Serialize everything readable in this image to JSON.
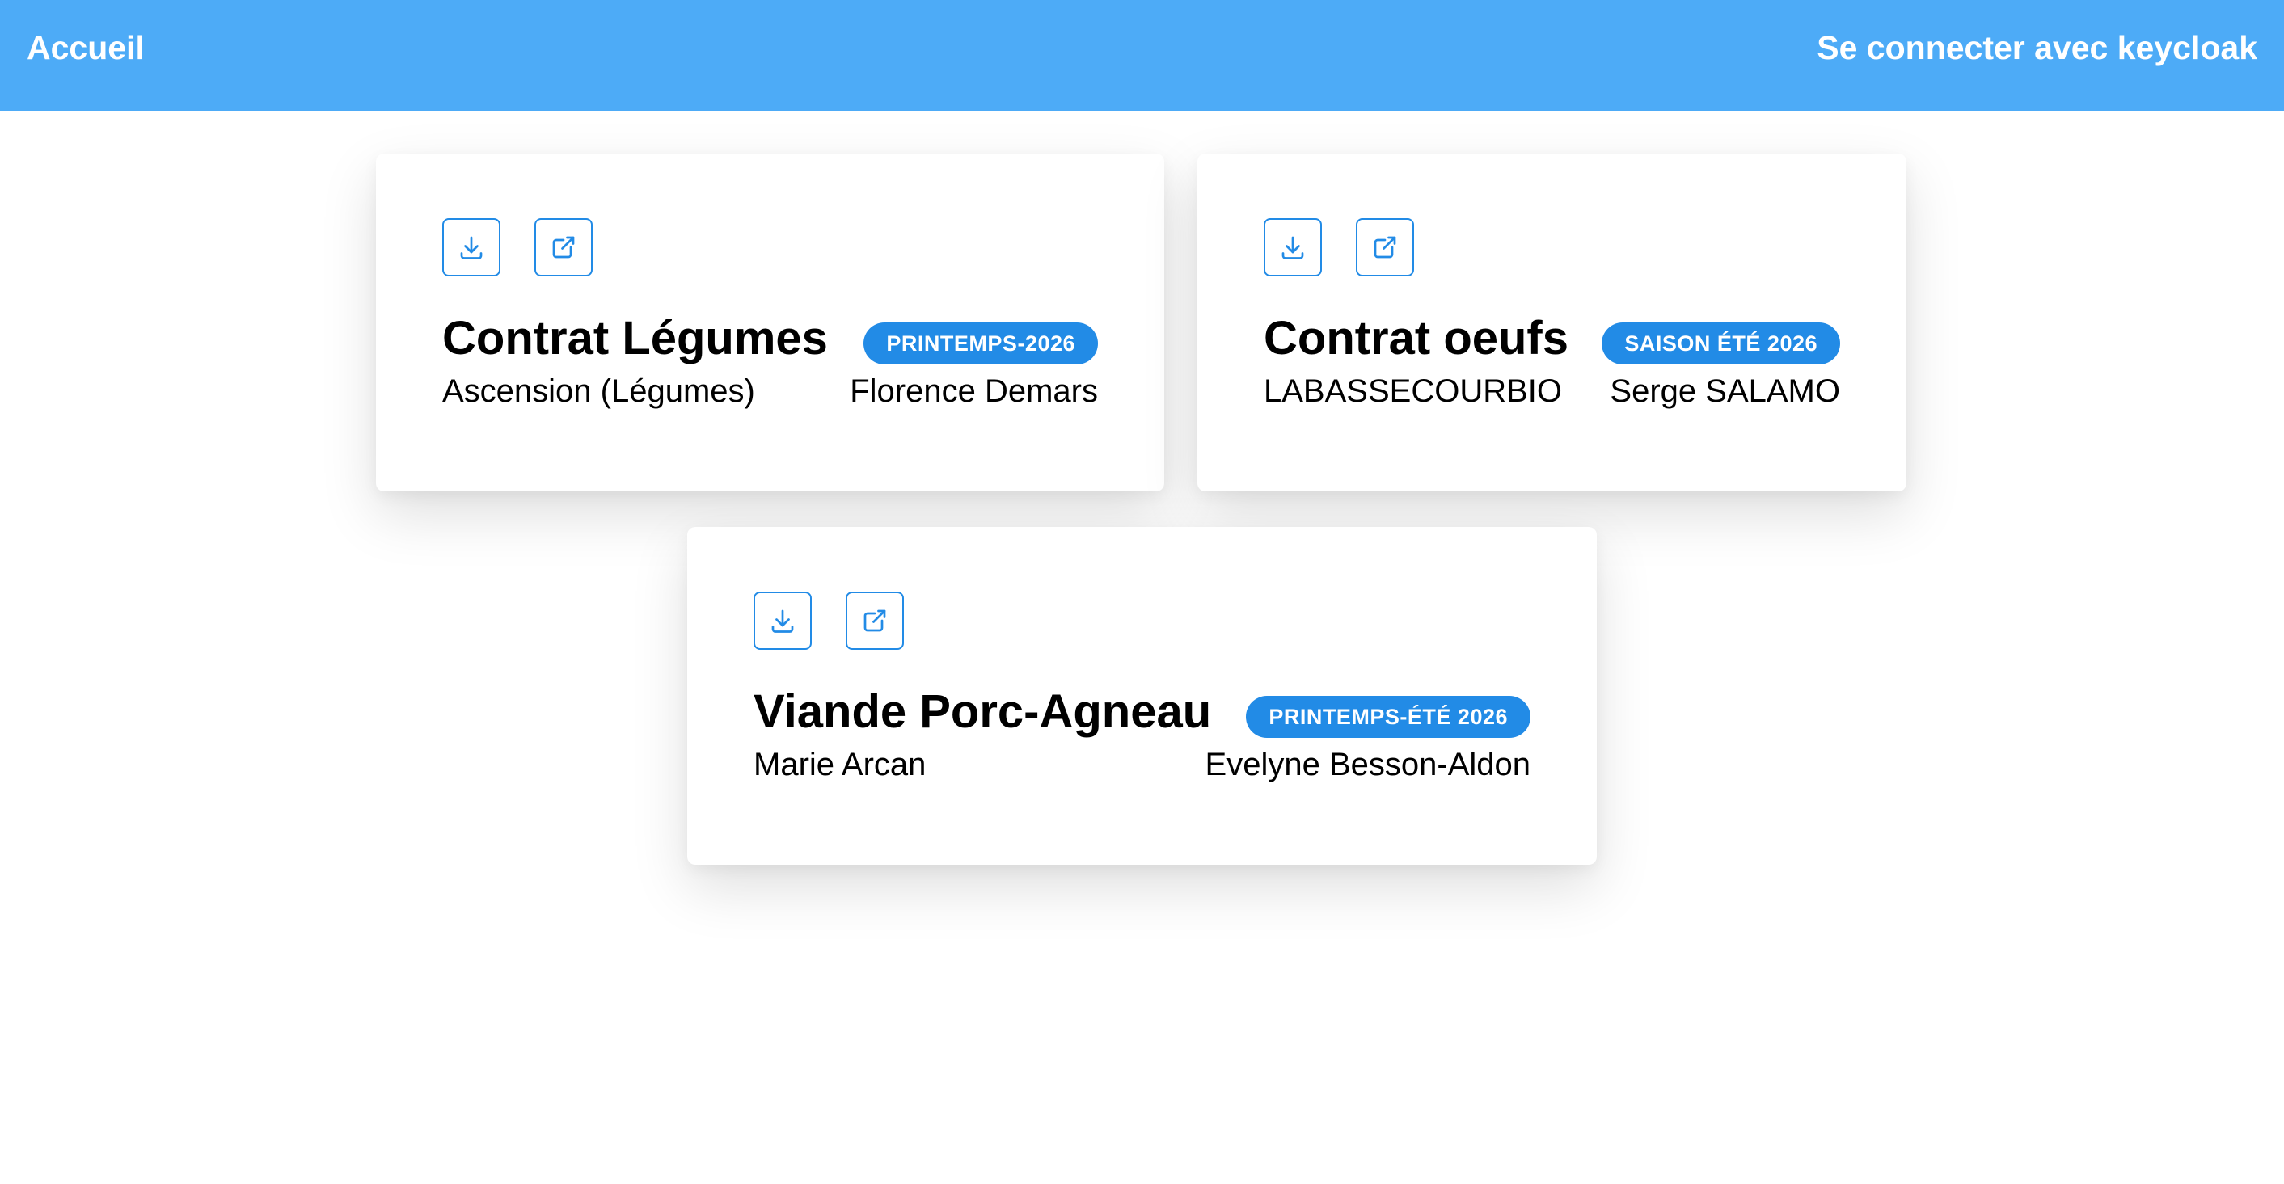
{
  "header": {
    "home_label": "Accueil",
    "login_label": "Se connecter avec keycloak"
  },
  "colors": {
    "header_bg": "#4dabf7",
    "accent": "#228be6"
  },
  "icons": {
    "download": "download-icon",
    "open": "external-link-icon"
  },
  "contracts": [
    {
      "title": "Contrat Légumes",
      "season": "PRINTEMPS-2026",
      "producer": "Ascension (Légumes)",
      "referent": "Florence Demars"
    },
    {
      "title": "Contrat oeufs",
      "season": "SAISON ÉTÉ 2026",
      "producer": "LABASSECOURBIO",
      "referent": "Serge SALAMO"
    },
    {
      "title": "Viande Porc-Agneau",
      "season": "PRINTEMPS-ÉTÉ 2026",
      "producer": "Marie Arcan",
      "referent": "Evelyne Besson-Aldon"
    }
  ]
}
